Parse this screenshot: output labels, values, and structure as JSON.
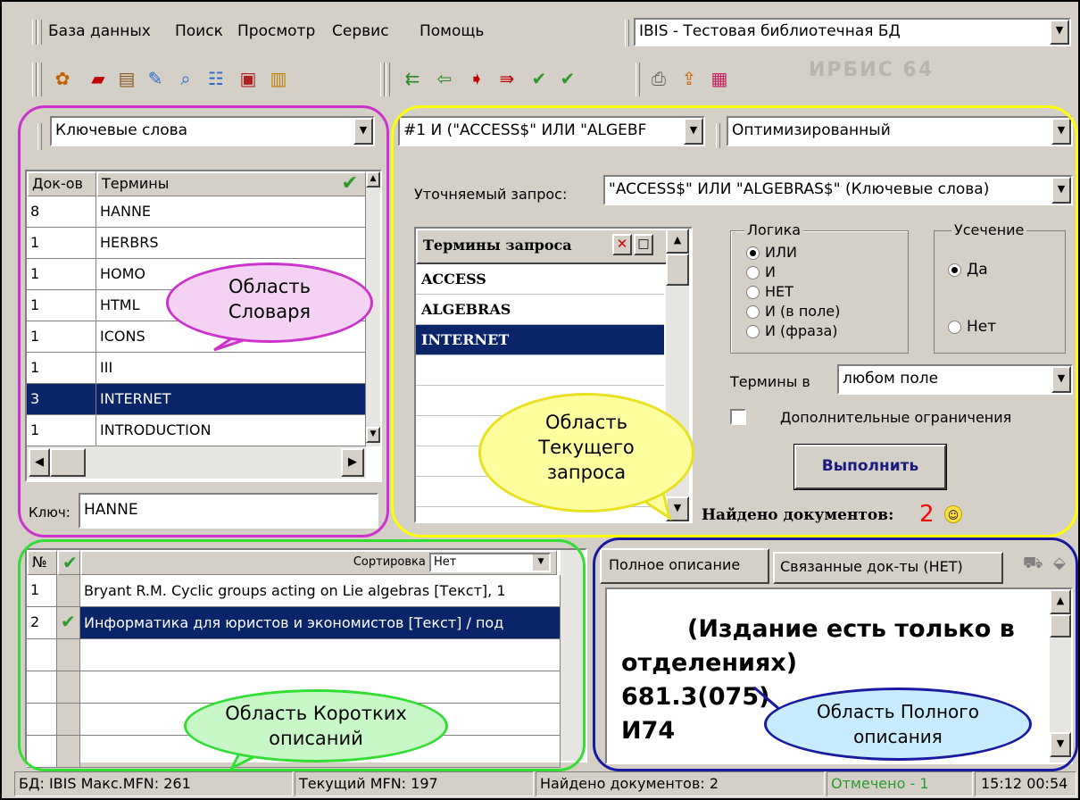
{
  "menu": {
    "items": [
      "База данных",
      "Поиск",
      "Просмотр",
      "Сервис",
      "Помощь"
    ]
  },
  "db_selector": {
    "value": "IBIS - Тестовая библиотечная БД"
  },
  "dictionary": {
    "index_select": "Ключевые слова",
    "columns": {
      "count": "Док-ов",
      "terms": "Термины"
    },
    "rows": [
      {
        "count": "8",
        "term": "HANNE"
      },
      {
        "count": "1",
        "term": "HERBRS"
      },
      {
        "count": "1",
        "term": "HOMO"
      },
      {
        "count": "1",
        "term": "HTML"
      },
      {
        "count": "1",
        "term": "ICONS"
      },
      {
        "count": "1",
        "term": "III"
      },
      {
        "count": "3",
        "term": "INTERNET"
      },
      {
        "count": "1",
        "term": "INTRODUCTION"
      }
    ],
    "key_label": "Ключ:",
    "key_value": "HANNE"
  },
  "query": {
    "history_select": "#1 И (\"ACCESS$\" ИЛИ \"ALGEBF",
    "mode_select": "Оптимизированный",
    "refine_label": "Уточняемый запрос:",
    "refine_value": "\"ACCESS$\" ИЛИ \"ALGEBRAS$\" (Ключевые слова)",
    "terms_header": "Термины запроса",
    "terms": [
      "ACCESS",
      "ALGEBRAS",
      "INTERNET"
    ],
    "logic_title": "Логика",
    "logic_options": [
      "ИЛИ",
      "И",
      "НЕТ",
      "И (в поле)",
      "И (фраза)"
    ],
    "truncation_title": "Усечение",
    "truncation_options": [
      "Да",
      "Нет"
    ],
    "terms_in_label": "Термины в",
    "terms_in_value": "любом поле",
    "extra_label": "Дополнительные ограничения",
    "run_label": "Выполнить",
    "found_label": "Найдено документов:",
    "found_count": "2"
  },
  "short": {
    "col_no": "№",
    "sort_label": "Сортировка",
    "sort_value": "Нет",
    "rows": [
      {
        "no": "1",
        "text": "Bryant R.M. Cyclic groups acting on Lie algebras [Текст], 1"
      },
      {
        "no": "2",
        "text": "Информатика для юристов и экономистов [Текст] / под"
      }
    ]
  },
  "full": {
    "tabs": [
      "Полное описание",
      "Связанные док-ты (НЕТ)"
    ],
    "line1": "(Издание есть только в",
    "line2": "отделениях)",
    "line3": "681.3(075)",
    "line4": "И74"
  },
  "callouts": {
    "dict": "Область\nСловаря",
    "query": "Область\nТекущего\nзапроса",
    "short": "Область Коротких\nописаний",
    "full": "Область Полного\nописания"
  },
  "statusbar": {
    "db": "БД: IBIS Макс.MFN: 261",
    "current": "Текущий MFN: 197",
    "found": "Найдено документов: 2",
    "marked": "Отмечено - 1",
    "time": "15:12  00:54"
  },
  "colors": {
    "selection": "#0a246a",
    "dict_frame": "#cc33cc",
    "query_frame": "#ffff00",
    "short_frame": "#33dd33",
    "full_frame": "#1a1aa0",
    "check": "#2a9a2a",
    "found_count": "#ff0000"
  }
}
